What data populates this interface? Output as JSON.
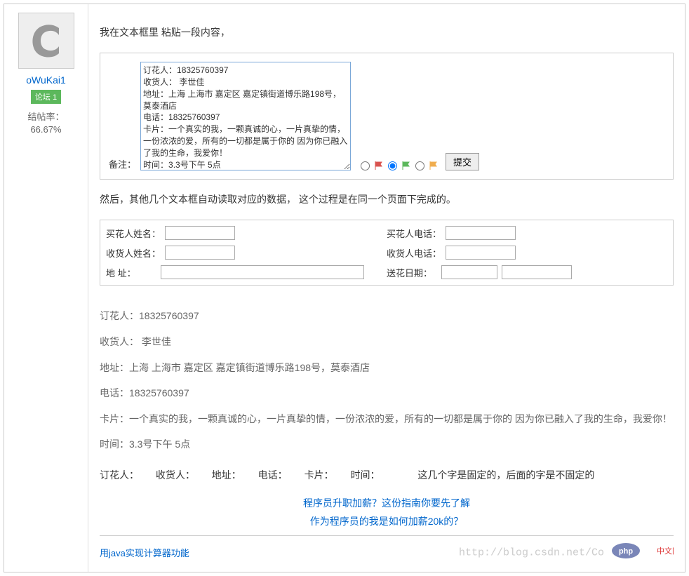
{
  "user": {
    "name": "oWuKai1",
    "badge": "论坛 1",
    "rate_label": "结帖率：",
    "rate_value": "66.67%"
  },
  "post": {
    "intro": "我在文本框里 粘贴一段内容，",
    "note_label": "备注：",
    "textarea_content": "订花人：18325760397\n收货人： 李世佳\n地址：上海 上海市 嘉定区 嘉定镇街道博乐路198号，莫泰酒店\n电话：18325760397\n卡片：一个真实的我，一颗真诚的心，一片真挚的情，一份浓浓的爱，所有的一切都是属于你的 因为你已融入了我的生命，我爱你！\n时间：3.3号下午 5点",
    "submit": "提交",
    "after": "然后，其他几个文本框自动读取对应的数据， 这个过程是在同一个页面下完成的。"
  },
  "form": {
    "buyer_name": "买花人姓名：",
    "buyer_phone": "买花人电话：",
    "recv_name": "收货人姓名：",
    "recv_phone": "收货人电话：",
    "address": "地 址：",
    "date": "送花日期："
  },
  "details": {
    "l1": "订花人：18325760397",
    "l2": "收货人： 李世佳",
    "l3": "地址：上海 上海市 嘉定区 嘉定镇街道博乐路198号，莫泰酒店",
    "l4": "电话：18325760397",
    "l5": "卡片：一个真实的我，一颗真诚的心，一片真挚的情，一份浓浓的爱，所有的一切都是属于你的 因为你已融入了我的生命，我爱你！",
    "l6": "时间：3.3号下午 5点"
  },
  "fixed": {
    "k1": "订花人：",
    "k2": "收货人：",
    "k3": "地址：",
    "k4": "电话：",
    "k5": "卡片：",
    "k6": "时间：",
    "note": "这几个字是固定的，后面的字是不固定的"
  },
  "promos": {
    "a": "程序员升职加薪？这份指南你要先了解",
    "b": "作为程序员的我是如何加薪20k的？"
  },
  "footer": {
    "link": "用java实现计算器功能",
    "watermark": "http://blog.csdn.net/Co",
    "wm_brand": "php中文网"
  },
  "colors": {
    "flag_red": "#d9534f",
    "flag_green": "#5cb85c",
    "flag_yellow": "#f0ad4e"
  }
}
